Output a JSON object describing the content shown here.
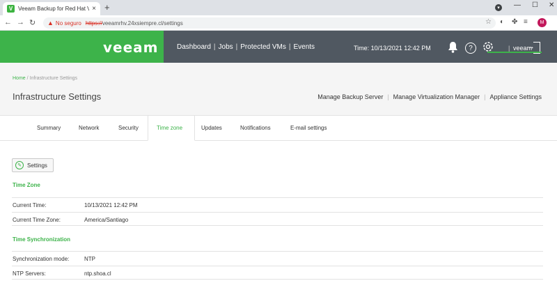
{
  "browser": {
    "tab_title": "Veeam Backup for Red Hat Virtu",
    "tab_close": "×",
    "new_tab": "+",
    "insecure_label": "No seguro",
    "url_scheme": "https://",
    "url_rest": "veeamrhv.24xsiempre.cl/settings",
    "profile_initial": "M"
  },
  "header": {
    "logo": "veeam",
    "nav": [
      "Dashboard",
      "Jobs",
      "Protected VMs",
      "Events"
    ],
    "nav_sep": "|",
    "time": "Time: 10/13/2021 12:42 PM",
    "help": "?",
    "user_sep": "|",
    "user": "veeam"
  },
  "page": {
    "breadcrumb_home": "Home",
    "breadcrumb_rest": " / Infrastructure Settings",
    "title": "Infrastructure Settings",
    "section_nav": [
      "Manage Backup Server",
      "Manage Virtualization Manager",
      "Appliance Settings"
    ],
    "section_sep": "|",
    "active_section": "Appliance Settings"
  },
  "subtabs": [
    "Summary",
    "Network",
    "Security",
    "Time zone",
    "Updates",
    "Notifications",
    "E-mail settings"
  ],
  "active_subtab": "Time zone",
  "settings_button": "Settings",
  "time_zone": {
    "title": "Time Zone",
    "rows": [
      {
        "label": "Current Time:",
        "value": "10/13/2021 12:42 PM"
      },
      {
        "label": "Current Time Zone:",
        "value": "America/Santiago"
      }
    ]
  },
  "time_sync": {
    "title": "Time Synchronization",
    "rows": [
      {
        "label": "Synchronization mode:",
        "value": "NTP"
      },
      {
        "label": "NTP Servers:",
        "value": "ntp.shoa.cl"
      }
    ]
  },
  "colors": {
    "accent": "#3db34a",
    "header_bg": "#505861",
    "link_red": "#d93025"
  }
}
